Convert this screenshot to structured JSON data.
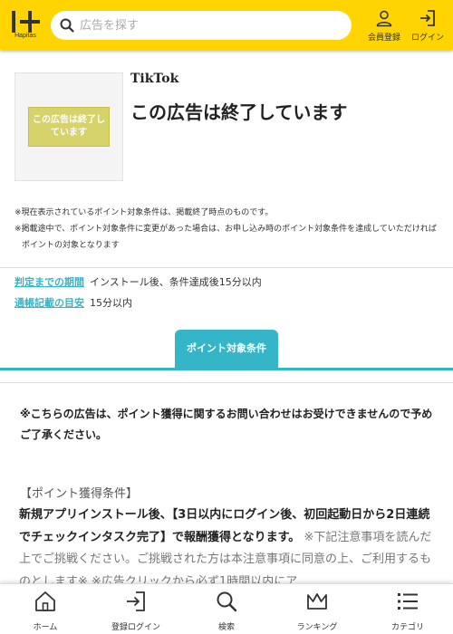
{
  "header": {
    "logo_text": "Hapitas",
    "search_placeholder": "広告を探す",
    "member_register_label": "会員登録",
    "login_label": "ログイン"
  },
  "ad": {
    "thumbnail_text": "この広告は終了しています",
    "app_name": "TikTok",
    "ended_title": "この広告は終了しています"
  },
  "notes": [
    "※現在表示されているポイント対象条件は、掲載終了時点のものです。",
    "※掲載途中で、ポイント対象条件に変更があった場合は、お申し込み時のポイント対象条件を達成していただければポイントの対象となります"
  ],
  "info": {
    "judgement_label": "判定までの期間",
    "judgement_value": "インストール後、条件達成後15分以内",
    "passbook_label": "通帳記載の目安",
    "passbook_value": "15分以内"
  },
  "tab": {
    "label": "ポイント対象条件"
  },
  "content": {
    "inquiry_note": "※こちらの広告は、ポイント獲得に関するお問い合わせはお受けできませんので予めご了承ください。",
    "conditions_heading": "【ポイント獲得条件】",
    "conditions_bold": "新規アプリインストール後、【3日以内にログイン後、初回起動日から2日連続でチェックインタスク完了】で報酬獲得となります。",
    "conditions_note": "※下記注意事項を読んだ上でご挑戦ください。ご挑戦された方は本注意事項に同意の上、ご利用するものとします※ ※広告クリックから必ず1時間以内にア"
  },
  "bottom_nav": {
    "home": "ホーム",
    "register_login": "登録ログイン",
    "search": "検索",
    "ranking": "ランキング",
    "category": "カテゴリ"
  },
  "colors": {
    "header_bg": "#ffd400",
    "accent": "#35b6c8"
  }
}
